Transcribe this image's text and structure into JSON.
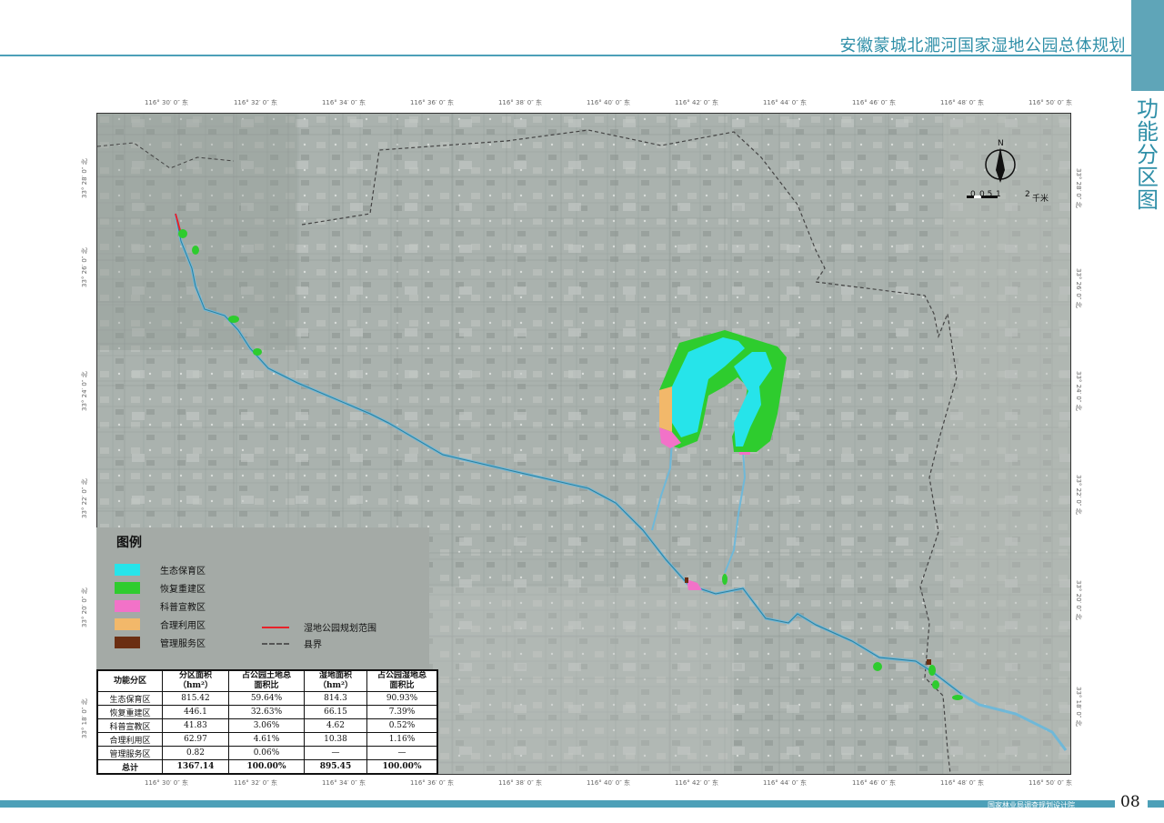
{
  "header": {
    "title": "安徽蒙城北淝河国家湿地公园总体规划",
    "side_title": [
      "功",
      "能",
      "分",
      "区",
      "图"
    ]
  },
  "footer": {
    "org": "国家林业局调查规划设计院",
    "page": "08"
  },
  "map": {
    "lon_ticks": [
      "116° 30′ 0″ 东",
      "116° 32′ 0″ 东",
      "116° 34′ 0″ 东",
      "116° 36′ 0″ 东",
      "116° 38′ 0″ 东",
      "116° 40′ 0″ 东",
      "116° 42′ 0″ 东",
      "116° 44′ 0″ 东",
      "116° 46′ 0″ 东",
      "116° 48′ 0″ 东",
      "116° 50′ 0″ 东"
    ],
    "lat_ticks": [
      "33° 28′ 0″ 北",
      "33° 26′ 0″ 北",
      "33° 24′ 0″ 北",
      "33° 22′ 0″ 北",
      "33° 20′ 0″ 北",
      "33° 18′ 0″ 北"
    ],
    "north_label": "N",
    "scale": {
      "labels": [
        "0",
        "0.5",
        "1",
        "2"
      ],
      "unit": "千米"
    },
    "colors": {
      "imagery": "#a9b1ad",
      "ecological": "#26e4ea",
      "restoration": "#2ecc2e",
      "science": "#f272c8",
      "utilization": "#f2b86a",
      "management": "#6b2e12",
      "park_boundary": "#e8222a",
      "county_boundary": "#444444",
      "river": "#6fb8d8"
    }
  },
  "legend": {
    "title": "图例",
    "zones": [
      {
        "label": "生态保育区",
        "color": "#26e4ea"
      },
      {
        "label": "恢复重建区",
        "color": "#2ecc2e"
      },
      {
        "label": "科普宣教区",
        "color": "#f272c8"
      },
      {
        "label": "合理利用区",
        "color": "#f2b86a"
      },
      {
        "label": "管理服务区",
        "color": "#6b2e12"
      }
    ],
    "lines": [
      {
        "label": "湿地公园规划范围",
        "style": "solid-red"
      },
      {
        "label": "县界",
        "style": "dashed-gray"
      }
    ]
  },
  "table": {
    "headers": [
      "功能分区",
      "分区面积\n（hm²）",
      "占公园土地总\n面积比",
      "湿地面积\n（hm²）",
      "占公园湿地总\n面积比"
    ],
    "rows": [
      [
        "生态保育区",
        "815.42",
        "59.64%",
        "814.3",
        "90.93%"
      ],
      [
        "恢复重建区",
        "446.1",
        "32.63%",
        "66.15",
        "7.39%"
      ],
      [
        "科普宣教区",
        "41.83",
        "3.06%",
        "4.62",
        "0.52%"
      ],
      [
        "合理利用区",
        "62.97",
        "4.61%",
        "10.38",
        "1.16%"
      ],
      [
        "管理服务区",
        "0.82",
        "0.06%",
        "—",
        "—"
      ]
    ],
    "total": [
      "总计",
      "1367.14",
      "100.00%",
      "895.45",
      "100.00%"
    ]
  }
}
